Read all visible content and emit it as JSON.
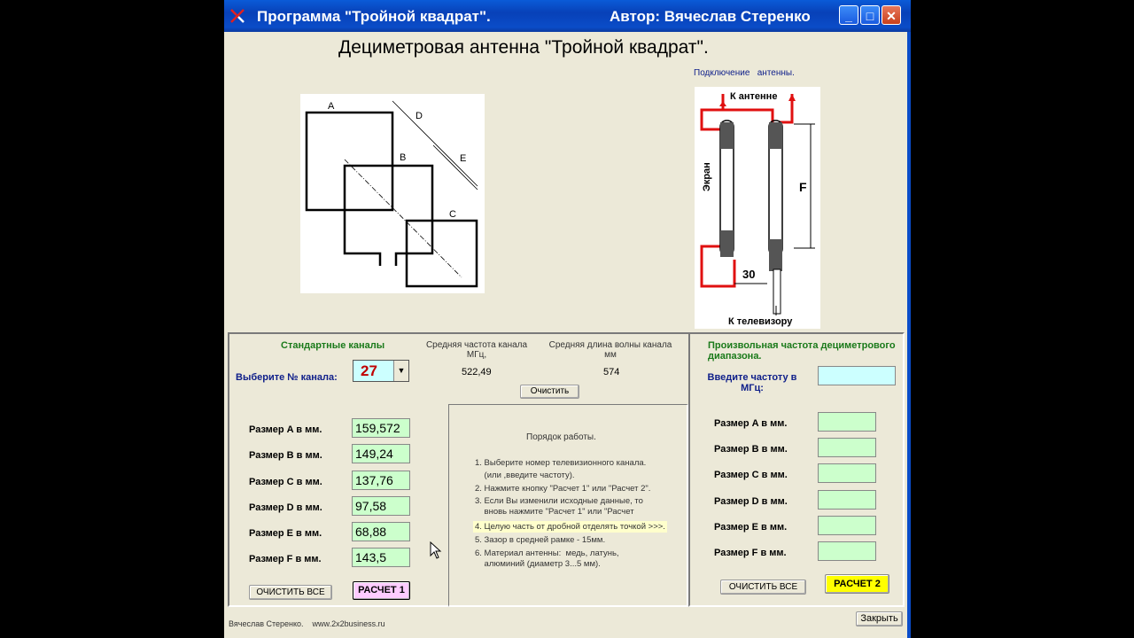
{
  "window": {
    "title": "Программа \"Тройной квадрат\".",
    "author": "Автор: Вячеслав Стеренко"
  },
  "heading": "Дециметровая антенна \"Тройной квадрат\".",
  "connection": {
    "title": "Подключение   антенны.",
    "to_antenna": "К антенне",
    "screen": "Экран",
    "to_tv": "К телевизору",
    "gap": "30",
    "size_label": "F"
  },
  "diagram": {
    "labels": [
      "A",
      "B",
      "C",
      "D",
      "E"
    ]
  },
  "standard": {
    "title": "Стандартные каналы",
    "choose_label": "Выберите № канала:",
    "channel": "27",
    "freq_header": "Средняя частота канала МГц,",
    "freq_value": "522,49",
    "wave_header": "Средняя длина волны канала мм",
    "wave_value": "574",
    "clear_button": "Очистить"
  },
  "results_left": [
    {
      "label": "Размер A в мм.",
      "value": "159,572"
    },
    {
      "label": "Размер B в мм.",
      "value": "149,24"
    },
    {
      "label": "Размер C в мм.",
      "value": "137,76"
    },
    {
      "label": "Размер D в мм.",
      "value": "97,58"
    },
    {
      "label": "Размер E в мм.",
      "value": "68,88"
    },
    {
      "label": "Размер F в мм.",
      "value": "143,5"
    }
  ],
  "left_buttons": {
    "clear_all": "ОЧИСТИТЬ ВСЕ",
    "calc1": "РАСЧЕТ 1"
  },
  "instructions": {
    "title": "Порядок работы.",
    "lines": [
      "1. Выберите номер телевизионного канала.",
      "    (или ,введите частоту).",
      "2. Нажмите кнопку \"Расчет 1\" или \"Расчет 2\".",
      "3. Если Вы изменили исходные данные, то",
      "    вновь нажмите \"Расчет 1\" или \"Расчет",
      "4. Целую часть от дробной отделять точкой >>>.",
      "5. Зазор в средней рамке - 15мм.",
      "6. Материал антенны:  медь, латунь,",
      "    алюминий (диаметр 3...5 мм)."
    ]
  },
  "custom": {
    "title": "Произвольная частота дециметрового диапазона.",
    "freq_label": "Введите частоту в МГц:",
    "freq_value": "",
    "labels": [
      "Размер A в мм.",
      "Размер B в мм.",
      "Размер C в мм.",
      "Размер D в мм.",
      "Размер E в мм.",
      "Размер F в мм."
    ],
    "clear_all": "ОЧИСТИТЬ ВСЕ",
    "calc2": "РАСЧЕТ 2"
  },
  "footer": {
    "credit": "Вячеслав Стеренко.    www.2x2business.ru",
    "close": "Закрыть"
  },
  "colors": {
    "titlebar": "#0a4cc8",
    "field": "#ccffcc",
    "freq_input": "#ccffff",
    "calc2": "#ffff00",
    "calc1": "#ffccff",
    "channel": "#c00000"
  }
}
